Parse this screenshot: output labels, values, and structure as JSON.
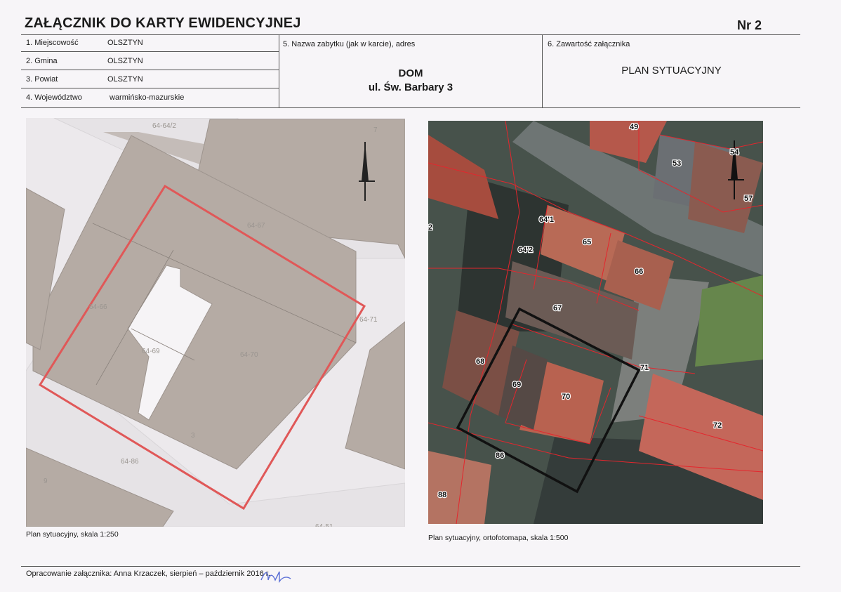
{
  "header": {
    "title": "ZAŁĄCZNIK DO KARTY EWIDENCYJNEJ",
    "number": "Nr 2"
  },
  "fields": {
    "miejscowosc": {
      "label": "1. Miejscowość",
      "value": "OLSZTYN"
    },
    "gmina": {
      "label": "2. Gmina",
      "value": "OLSZTYN"
    },
    "powiat": {
      "label": "3. Powiat",
      "value": "OLSZTYN"
    },
    "wojewodztwo": {
      "label": "4. Województwo",
      "value": "warmińsko-mazurskie"
    },
    "zabytek": {
      "label": "5. Nazwa zabytku (jak w karcie), adres",
      "name": "DOM",
      "address": "ul. Św. Barbary 3"
    },
    "zawartosc": {
      "label": "6. Zawartość załącznika",
      "value": "PLAN SYTUACYJNY"
    }
  },
  "left_map": {
    "caption": "Plan sytuacyjny, skala 1:250",
    "labels": [
      "64-64/2",
      "64-67",
      "64-71",
      "64-66",
      "64-69",
      "64-70",
      "64-86",
      "64-51",
      "3",
      "9",
      "7"
    ]
  },
  "right_map": {
    "caption": "Plan sytuacyjny, ortofotomapa, skala 1:500",
    "labels": [
      "49",
      "53",
      "54",
      "57",
      "2",
      "64'1",
      "64'2",
      "65",
      "66",
      "67",
      "68",
      "69",
      "70",
      "71",
      "72",
      "86",
      "88"
    ]
  },
  "footer": {
    "text": "Opracowanie załącznika: Anna Krzaczek, sierpień – październik 2016 r."
  }
}
